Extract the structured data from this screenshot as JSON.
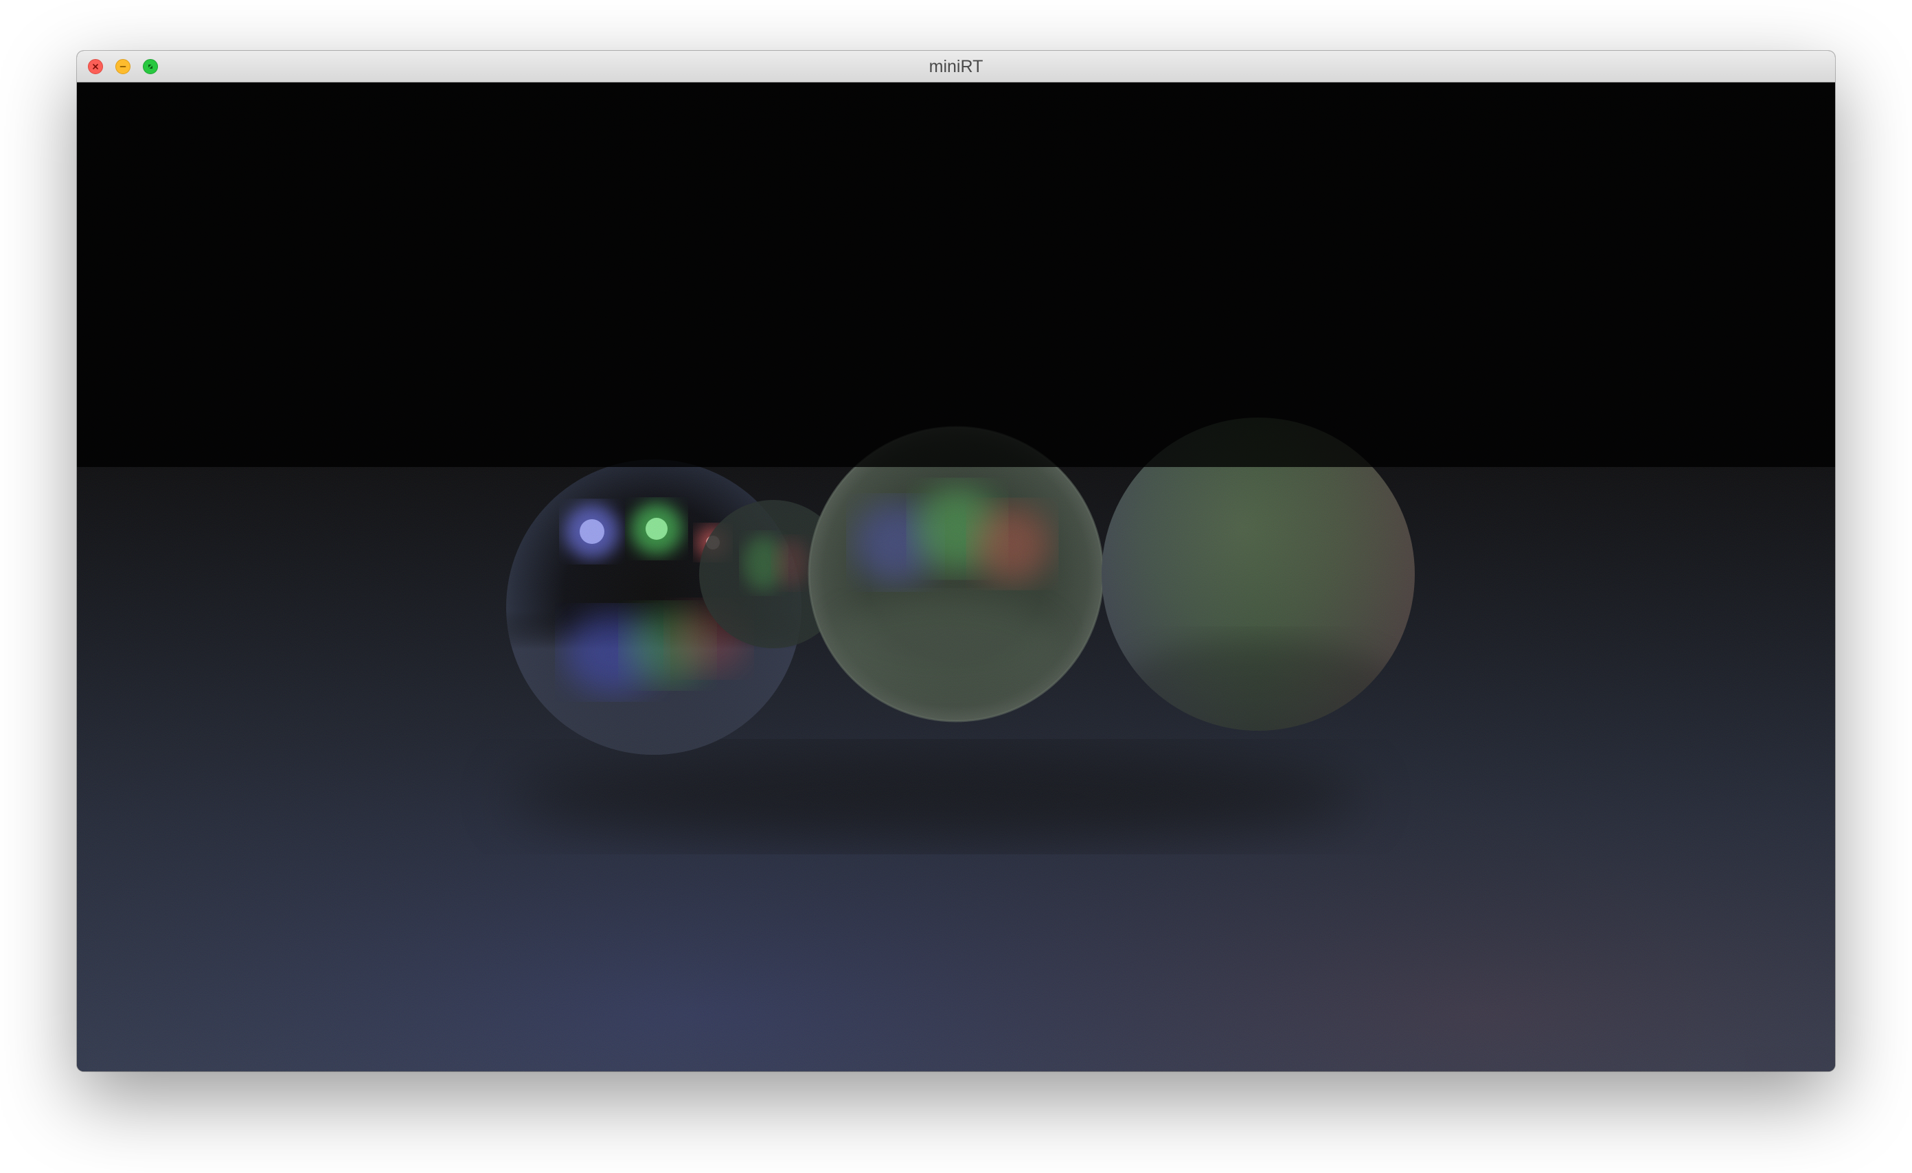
{
  "window": {
    "title": "miniRT"
  },
  "controls": {
    "close": "close-icon",
    "minimize": "minimize-icon",
    "maximize": "fullscreen-icon"
  },
  "scene": {
    "background": "#000000",
    "floor_color": "#2c3448",
    "light_colors": [
      "#6f78ff",
      "#57ff6a",
      "#ff6262"
    ]
  }
}
